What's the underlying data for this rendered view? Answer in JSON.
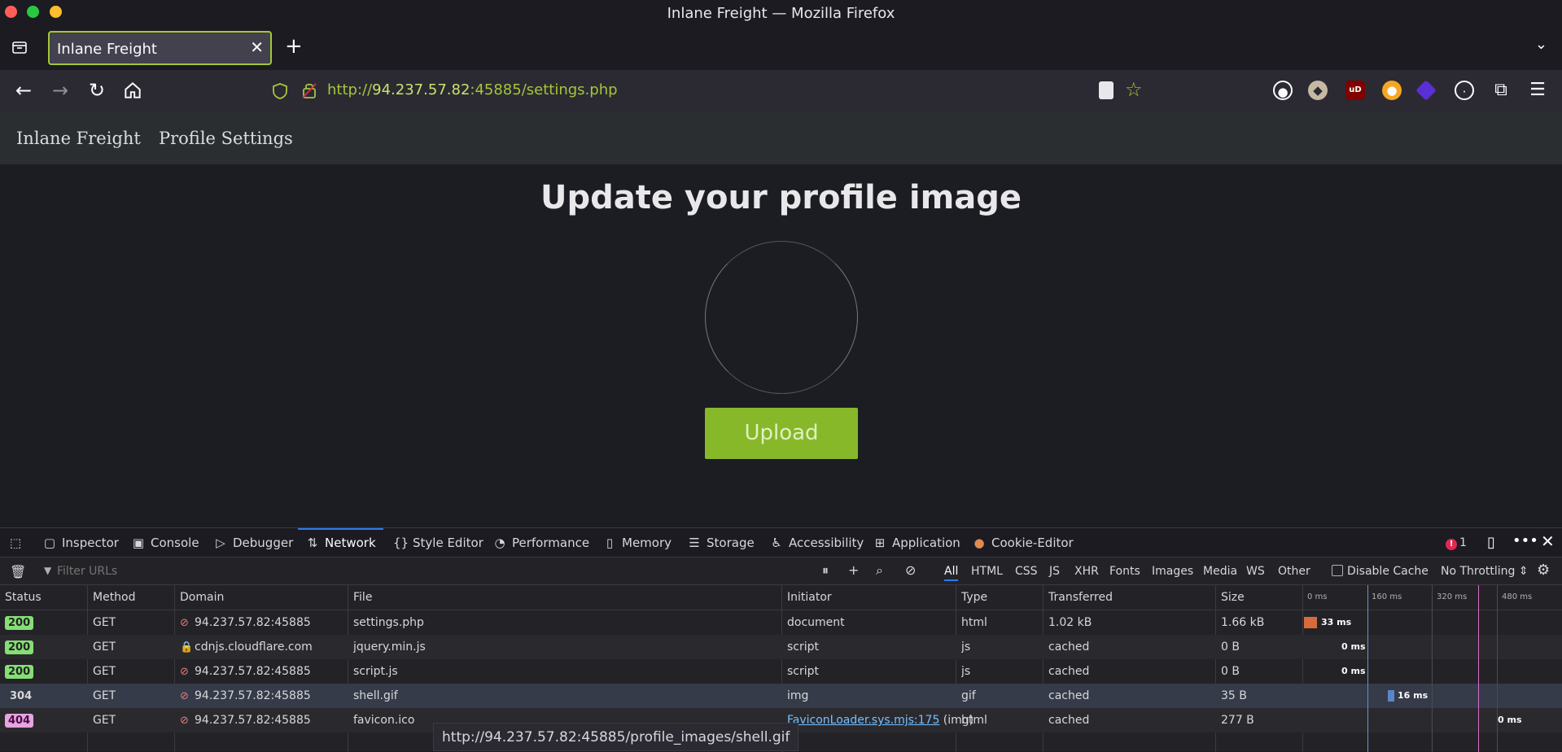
{
  "window": {
    "title": "Inlane Freight — Mozilla Firefox"
  },
  "tabs": {
    "active_title": "Inlane Freight",
    "close_glyph": "✕",
    "new_tab_glyph": "+",
    "overflow_glyph": "⌄"
  },
  "nav": {
    "url_prefix": "http://",
    "url_host": "94.237.57.82",
    "url_rest": ":45885/settings.php"
  },
  "page": {
    "nav_brand": "Inlane Freight",
    "nav_profile": "Profile Settings",
    "heading": "Update your profile image",
    "upload_label": "Upload"
  },
  "devtools": {
    "tabs": {
      "inspector": "Inspector",
      "console": "Console",
      "debugger": "Debugger",
      "network": "Network",
      "style_editor": "Style Editor",
      "performance": "Performance",
      "memory": "Memory",
      "storage": "Storage",
      "accessibility": "Accessibility",
      "application": "Application",
      "cookie_editor": "Cookie-Editor"
    },
    "error_count": "1",
    "filter_placeholder": "Filter URLs",
    "type_filters": {
      "all": "All",
      "html": "HTML",
      "css": "CSS",
      "js": "JS",
      "xhr": "XHR",
      "fonts": "Fonts",
      "images": "Images",
      "media": "Media",
      "ws": "WS",
      "other": "Other"
    },
    "disable_cache": "Disable Cache",
    "throttling": "No Throttling ⇕",
    "columns": {
      "status": "Status",
      "method": "Method",
      "domain": "Domain",
      "file": "File",
      "initiator": "Initiator",
      "type": "Type",
      "transferred": "Transferred",
      "size": "Size"
    },
    "timeline_ticks": [
      "0 ms",
      "160 ms",
      "320 ms",
      "480 ms"
    ],
    "rows": [
      {
        "status": "200",
        "method": "GET",
        "domain": "94.237.57.82:45885",
        "file": "settings.php",
        "initiator": "document",
        "type": "html",
        "transferred": "1.02 kB",
        "size": "1.66 kB",
        "timing": "33 ms"
      },
      {
        "status": "200",
        "method": "GET",
        "domain": "cdnjs.cloudflare.com",
        "file": "jquery.min.js",
        "initiator": "script",
        "type": "js",
        "transferred": "cached",
        "size": "0 B",
        "timing": "0 ms"
      },
      {
        "status": "200",
        "method": "GET",
        "domain": "94.237.57.82:45885",
        "file": "script.js",
        "initiator": "script",
        "type": "js",
        "transferred": "cached",
        "size": "0 B",
        "timing": "0 ms"
      },
      {
        "status": "304",
        "method": "GET",
        "domain": "94.237.57.82:45885",
        "file": "shell.gif",
        "initiator": "img",
        "type": "gif",
        "transferred": "cached",
        "size": "35 B",
        "timing": "16 ms"
      },
      {
        "status": "404",
        "method": "GET",
        "domain": "94.237.57.82:45885",
        "file": "favicon.ico",
        "initiator": "FaviconLoader.sys.mjs:175",
        "initiator_suffix": " (img)",
        "type": "html",
        "transferred": "cached",
        "size": "277 B",
        "timing": "0 ms"
      }
    ],
    "status_tooltip": "http://94.237.57.82:45885/profile_images/shell.gif"
  }
}
